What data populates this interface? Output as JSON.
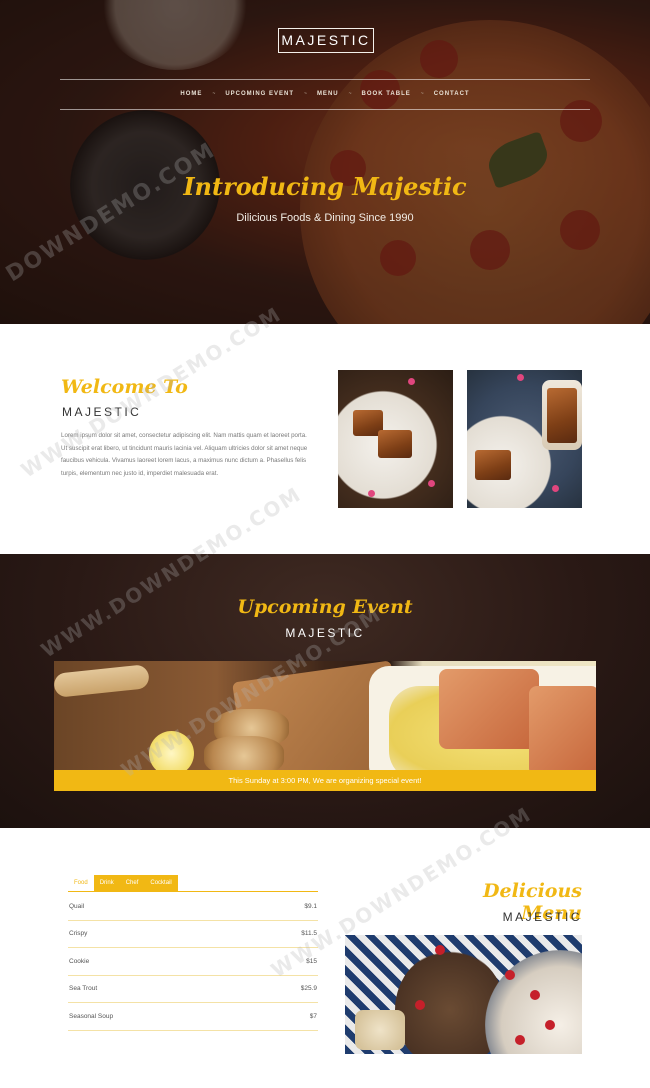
{
  "brand": "MAJESTIC",
  "nav": {
    "items": [
      "HOME",
      "UPCOMING EVENT",
      "MENU",
      "BOOK TABLE",
      "CONTACT"
    ],
    "separator": "~"
  },
  "hero": {
    "title": "Introducing Majestic",
    "subtitle": "Dilicious Foods & Dining Since 1990"
  },
  "welcome": {
    "title": "Welcome To",
    "brand": "MAJESTIC",
    "text": "Lorem ipsum dolor sit amet, consectetur adipiscing elit. Nam mattis quam et laoreet porta. Ut suscipit erat libero, ut tincidunt mauris lacinia vel. Aliquam ultricies dolor sit amet neque faucibus vehicula. Vivamus laoreet lorem lacus, a maximus nunc dictum a. Phasellus felis turpis, elementum nec justo id, imperdiet malesuada erat."
  },
  "event": {
    "title": "Upcoming Event",
    "brand": "MAJESTIC",
    "banner": "This Sunday at 3:00 PM, We are organizing special event!"
  },
  "menu": {
    "title": "Delicious Menu",
    "brand": "MAJESTIC",
    "tabs": [
      "Food",
      "Drink",
      "Chef",
      "Cocktail"
    ],
    "active_tab": "Food",
    "items": [
      {
        "name": "Quail",
        "price": "$9.1"
      },
      {
        "name": "Crispy",
        "price": "$11.5"
      },
      {
        "name": "Cookie",
        "price": "$15"
      },
      {
        "name": "Sea Trout",
        "price": "$25.9"
      },
      {
        "name": "Seasonal Soup",
        "price": "$7"
      }
    ]
  },
  "watermark": {
    "text1": "DOWNDEMO.COM",
    "text2": "WWW.DOWNDEMO.COM"
  },
  "colors": {
    "accent": "#f1b814",
    "dark_bg": "#2a1915"
  }
}
